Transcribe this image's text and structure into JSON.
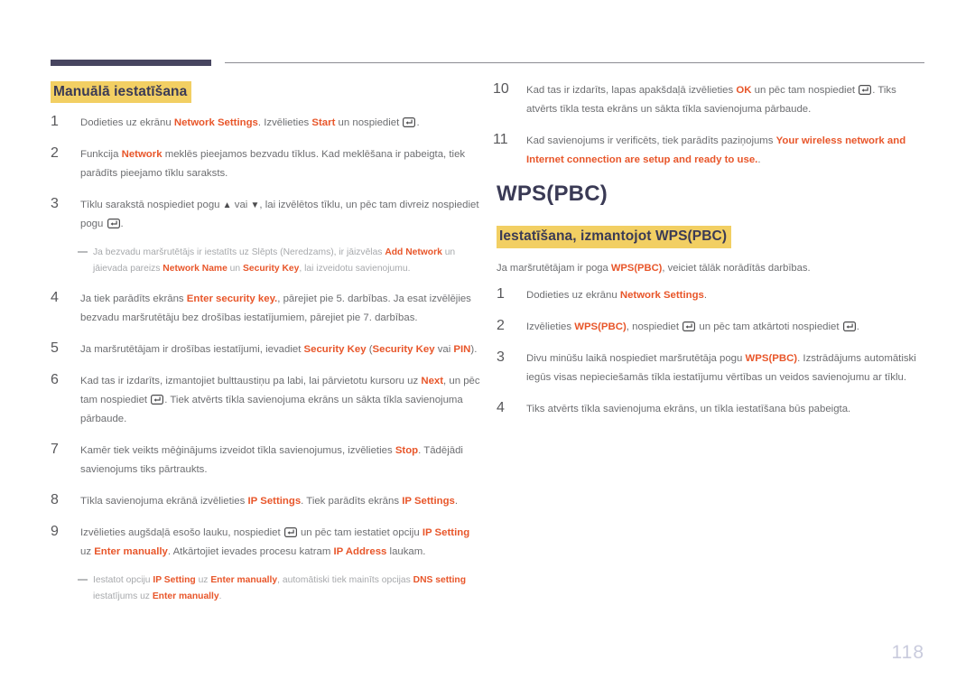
{
  "page": {
    "number": "118"
  },
  "left_column": {
    "heading": "Manuālā iestatīšana",
    "steps": [
      {
        "num": "1",
        "html": "Dodieties uz ekrānu <b class=\"k\">Network Settings</b>. Izvēlieties <b class=\"k\">Start</b> un nospiediet [ENTER]."
      },
      {
        "num": "2",
        "html": "Funkcija <b class=\"k\">Network</b> meklēs pieejamos bezvadu tīklus. Kad meklēšana ir pabeigta, tiek parādīts pieejamo tīklu saraksts."
      },
      {
        "num": "3",
        "html": "Tīklu sarakstā nospiediet pogu [UP] vai [DOWN], lai izvēlētos tīklu, un pēc tam divreiz nospiediet pogu [ENTER]."
      },
      {
        "num": "4",
        "html": "Ja tiek parādīts ekrāns <b class=\"k\">Enter security key.</b>, pārejiet pie 5. darbības. Ja esat izvēlējies bezvadu maršrutētāju bez drošības iestatījumiem, pārejiet pie 7. darbības."
      },
      {
        "num": "5",
        "html": "Ja maršrutētājam ir drošības iestatījumi, ievadiet <b class=\"k\">Security Key</b> (<b class=\"k\">Security Key</b> vai <b class=\"k\">PIN</b>)."
      },
      {
        "num": "6",
        "html": "Kad tas ir izdarīts, izmantojiet bulttaustiņu pa labi, lai pārvietotu kursoru uz <b class=\"k\">Next</b>, un pēc tam nospiediet [ENTER]. Tiek atvērts tīkla savienojuma ekrāns un sākta tīkla savienojuma pārbaude."
      },
      {
        "num": "7",
        "html": "Kamēr tiek veikts mēģinājums izveidot tīkla savienojumus, izvēlieties <b class=\"k\">Stop</b>. Tādējādi savienojums tiks pārtraukts."
      },
      {
        "num": "8",
        "html": "Tīkla savienojuma ekrānā izvēlieties <b class=\"k\">IP Settings</b>. Tiek parādīts ekrāns <b class=\"k\">IP Settings</b>."
      },
      {
        "num": "9",
        "html": "Izvēlieties augšdaļā esošo lauku, nospiediet [ENTER] un pēc tam iestatiet opciju <b class=\"k\">IP Setting</b> uz <b class=\"k\">Enter manually</b>. Atkārtojiet ievades procesu katram <b class=\"k\">IP Address</b> laukam."
      }
    ],
    "note_after_step3": "Ja bezvadu maršrutētājs ir iestatīts uz Slēpts (Neredzams), ir jāizvēlas <b class=\"k\">Add Network</b> un jāievada pareizs <b class=\"k\">Network Name</b> un <b class=\"k\">Security Key</b>, lai izveidotu savienojumu.",
    "note_after_step9": "Iestatot opciju <b class=\"k\">IP Setting</b> uz <b class=\"k\">Enter manually</b>, automātiski tiek mainīts opcijas <b class=\"k\">DNS setting</b> iestatījums uz <b class=\"k\">Enter manually</b>."
  },
  "right_column": {
    "steps_continued": [
      {
        "num": "10",
        "html": "Kad tas ir izdarīts, lapas apakšdaļā izvēlieties <b class=\"k\">OK</b> un pēc tam nospiediet [ENTER]. Tiks atvērts tīkla testa ekrāns un sākta tīkla savienojuma pārbaude."
      },
      {
        "num": "11",
        "html": "Kad savienojums ir verificēts, tiek parādīts paziņojums <b class=\"k\">Your wireless network and Internet connection are setup and ready to use.</b>."
      }
    ],
    "section_title": "WPS(PBC)",
    "subsection_heading": "Iestatīšana, izmantojot WPS(PBC)",
    "lead": "Ja maršrutētājam ir poga <b class=\"k\">WPS(PBC)</b>, veiciet tālāk norādītās darbības.",
    "steps": [
      {
        "num": "1",
        "html": "Dodieties uz ekrānu <b class=\"k\">Network Settings</b>."
      },
      {
        "num": "2",
        "html": "Izvēlieties <b class=\"k\">WPS(PBC)</b>, nospiediet [ENTER] un pēc tam atkārtoti nospiediet [ENTER]."
      },
      {
        "num": "3",
        "html": "Divu minūšu laikā nospiediet maršrutētāja pogu <b class=\"k\">WPS(PBC)</b>. Izstrādājums automātiski iegūs visas nepieciešamās tīkla iestatījumu vērtības un veidos savienojumu ar tīklu."
      },
      {
        "num": "4",
        "html": "Tiks atvērts tīkla savienojuma ekrāns, un tīkla iestatīšana būs pabeigta."
      }
    ]
  },
  "icons": {
    "enter_key": "enter-key-icon",
    "arrow_up": "▲",
    "arrow_down": "▼"
  },
  "colors": {
    "accent": "#e8562a",
    "highlight": "#f2cf63",
    "heading_text": "#3a3a55",
    "rule_dark": "#474560",
    "body_text": "#6d6e71",
    "note_text": "#a7a9ac",
    "page_number": "#c9cbdd"
  }
}
